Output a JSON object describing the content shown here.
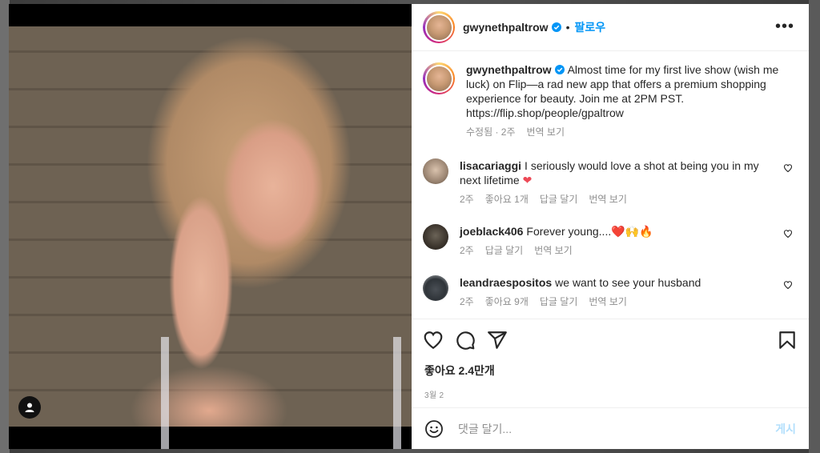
{
  "post": {
    "username": "gwynethpaltrow",
    "follow_label": "팔로우",
    "dot": "•",
    "more_label": "•••",
    "caption": {
      "username": "gwynethpaltrow",
      "text": "Almost time for my first live show (wish me luck) on Flip—a rad new app that offers a premium shopping experience for beauty. Join me at 2PM PST. https://flip.shop/people/gpaltrow",
      "edited": "수정됨 · 2주",
      "translate": "번역 보기"
    },
    "comments": [
      {
        "username": "lisacariaggi",
        "text": "I seriously would love a shot at being you in my next lifetime",
        "emoji": "❤️",
        "time": "2주",
        "likes": "좋아요 1개",
        "reply": "답글 달기",
        "translate": "번역 보기"
      },
      {
        "username": "joeblack406",
        "text": "Forever young....",
        "emoji": "❤️🙌🔥",
        "time": "2주",
        "likes": "",
        "reply": "답글 달기",
        "translate": "번역 보기"
      },
      {
        "username": "leandraespositos",
        "text": "we want to see your husband",
        "emoji": "",
        "time": "2주",
        "likes": "좋아요 9개",
        "reply": "답글 달기",
        "translate": "번역 보기"
      }
    ],
    "likes_label": "좋아요 2.4만개",
    "date": "3월 2",
    "comment_placeholder": "댓글 달기...",
    "post_button": "게시"
  },
  "colors": {
    "accent": "#0095f6",
    "heart_red": "#ed4956",
    "muted": "#8e8e8e",
    "post_button_disabled": "#b2dffc"
  },
  "icons": [
    "verified-icon",
    "more-icon",
    "heart-icon",
    "comment-icon",
    "share-icon",
    "bookmark-icon",
    "emoji-icon",
    "user-icon"
  ]
}
